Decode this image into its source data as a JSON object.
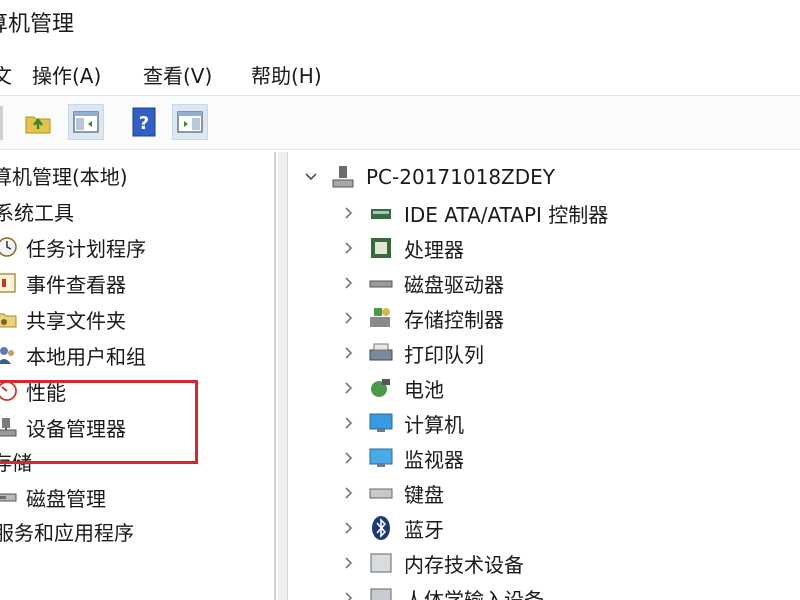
{
  "window": {
    "title": "算机管理"
  },
  "menu": [
    "操作(A)",
    "查看(V)",
    "帮助(H)"
  ],
  "toolbar": {
    "icons": [
      "folder-up-icon",
      "show-hide-pane-icon",
      "help-icon",
      "action-pane-icon"
    ]
  },
  "left_tree": {
    "root": "算机管理(本地)",
    "items": [
      {
        "label": "系统工具",
        "icon": "",
        "level": 1
      },
      {
        "label": "任务计划程序",
        "icon": "clock-icon",
        "level": 2
      },
      {
        "label": "事件查看器",
        "icon": "event-viewer-icon",
        "level": 2
      },
      {
        "label": "共享文件夹",
        "icon": "shared-folder-icon",
        "level": 2
      },
      {
        "label": "本地用户和组",
        "icon": "users-icon",
        "level": 2
      },
      {
        "label": "性能",
        "icon": "performance-icon",
        "level": 2
      },
      {
        "label": "设备管理器",
        "icon": "device-manager-icon",
        "level": 2,
        "selected": true
      },
      {
        "label": "存储",
        "icon": "",
        "level": 1
      },
      {
        "label": "磁盘管理",
        "icon": "disk-icon",
        "level": 2
      },
      {
        "label": "服务和应用程序",
        "icon": "",
        "level": 1
      }
    ]
  },
  "device_tree": {
    "root": "PC-20171018ZDEY",
    "items": [
      {
        "label": "IDE ATA/ATAPI 控制器",
        "icon": "ide-controller-icon"
      },
      {
        "label": "处理器",
        "icon": "processor-icon"
      },
      {
        "label": "磁盘驱动器",
        "icon": "disk-drive-icon"
      },
      {
        "label": "存储控制器",
        "icon": "storage-controller-icon"
      },
      {
        "label": "打印队列",
        "icon": "printer-icon"
      },
      {
        "label": "电池",
        "icon": "battery-icon"
      },
      {
        "label": "计算机",
        "icon": "computer-icon"
      },
      {
        "label": "监视器",
        "icon": "monitor-icon"
      },
      {
        "label": "键盘",
        "icon": "keyboard-icon"
      },
      {
        "label": "蓝牙",
        "icon": "bluetooth-icon"
      },
      {
        "label": "内存技术设备",
        "icon": "memory-device-icon"
      },
      {
        "label": "人体学输入设备",
        "icon": "hid-icon"
      }
    ]
  },
  "colors": {
    "highlight_border": "#d9262c",
    "accent": "#2f7fd1"
  }
}
